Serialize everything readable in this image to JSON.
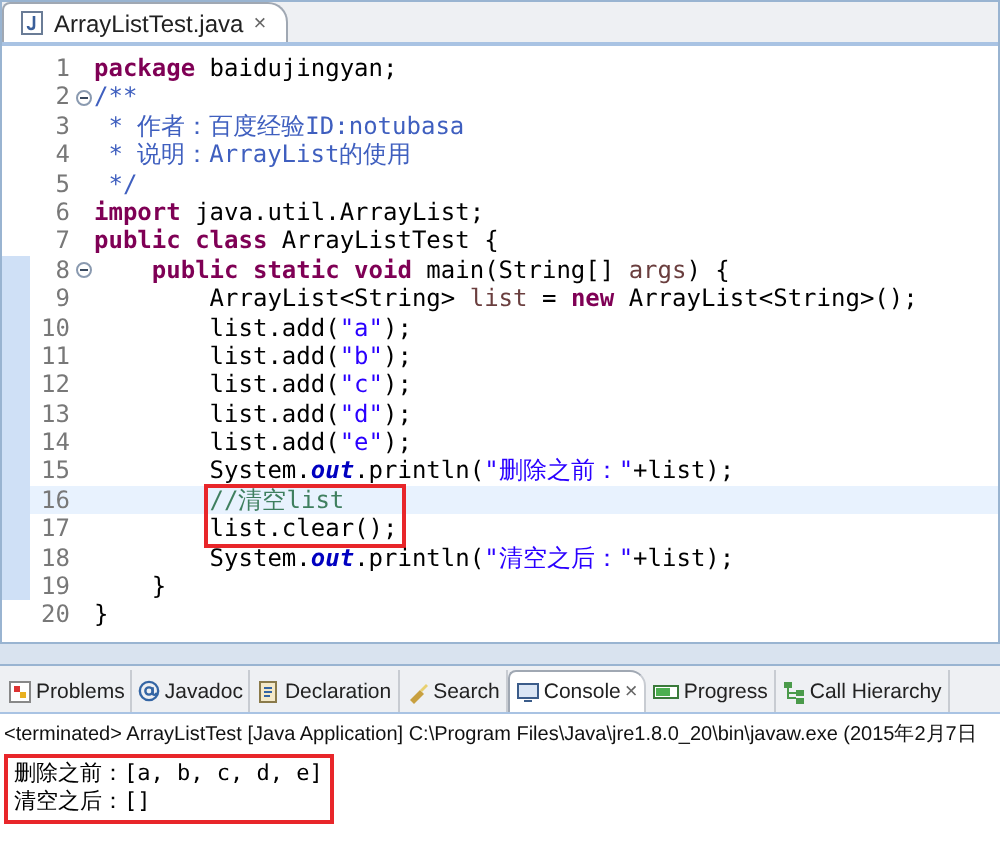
{
  "editor": {
    "tab": {
      "title": "ArrayListTest.java",
      "close": "×",
      "selected": true
    },
    "lines": [
      {
        "number": "1",
        "tokens": [
          {
            "kind": "keyword",
            "text": "package"
          },
          {
            "kind": "plain",
            "text": " baidujingyan;"
          }
        ]
      },
      {
        "number": "2",
        "fold": true,
        "tokens": [
          {
            "kind": "doc",
            "text": "/**"
          }
        ]
      },
      {
        "number": "3",
        "tokens": [
          {
            "kind": "doc",
            "text": " * 作者：百度经验ID:notubasa"
          }
        ]
      },
      {
        "number": "4",
        "tokens": [
          {
            "kind": "doc",
            "text": " * 说明：ArrayList的使用"
          }
        ]
      },
      {
        "number": "5",
        "tokens": [
          {
            "kind": "doc",
            "text": " */"
          }
        ]
      },
      {
        "number": "6",
        "tokens": [
          {
            "kind": "keyword",
            "text": "import"
          },
          {
            "kind": "plain",
            "text": " java.util.ArrayList;"
          }
        ]
      },
      {
        "number": "7",
        "tokens": [
          {
            "kind": "keyword",
            "text": "public class"
          },
          {
            "kind": "plain",
            "text": " ArrayListTest {"
          }
        ]
      },
      {
        "number": "8",
        "fold": true,
        "in_range": true,
        "tokens": [
          {
            "kind": "keyword",
            "text": "    public static void"
          },
          {
            "kind": "plain",
            "text": " main(String[] "
          },
          {
            "kind": "variable",
            "text": "args"
          },
          {
            "kind": "plain",
            "text": ") {"
          }
        ]
      },
      {
        "number": "9",
        "in_range": true,
        "tokens": [
          {
            "kind": "plain",
            "text": "        ArrayList<String> "
          },
          {
            "kind": "variable",
            "text": "list"
          },
          {
            "kind": "plain",
            "text": " = "
          },
          {
            "kind": "keyword",
            "text": "new"
          },
          {
            "kind": "plain",
            "text": " ArrayList<String>();"
          }
        ]
      },
      {
        "number": "10",
        "in_range": true,
        "tokens": [
          {
            "kind": "plain",
            "text": "        list.add("
          },
          {
            "kind": "string",
            "text": "\"a\""
          },
          {
            "kind": "plain",
            "text": ");"
          }
        ]
      },
      {
        "number": "11",
        "in_range": true,
        "tokens": [
          {
            "kind": "plain",
            "text": "        list.add("
          },
          {
            "kind": "string",
            "text": "\"b\""
          },
          {
            "kind": "plain",
            "text": ");"
          }
        ]
      },
      {
        "number": "12",
        "in_range": true,
        "tokens": [
          {
            "kind": "plain",
            "text": "        list.add("
          },
          {
            "kind": "string",
            "text": "\"c\""
          },
          {
            "kind": "plain",
            "text": ");"
          }
        ]
      },
      {
        "number": "13",
        "in_range": true,
        "tokens": [
          {
            "kind": "plain",
            "text": "        list.add("
          },
          {
            "kind": "string",
            "text": "\"d\""
          },
          {
            "kind": "plain",
            "text": ");"
          }
        ]
      },
      {
        "number": "14",
        "in_range": true,
        "tokens": [
          {
            "kind": "plain",
            "text": "        list.add("
          },
          {
            "kind": "string",
            "text": "\"e\""
          },
          {
            "kind": "plain",
            "text": ");"
          }
        ]
      },
      {
        "number": "15",
        "in_range": true,
        "tokens": [
          {
            "kind": "plain",
            "text": "        System."
          },
          {
            "kind": "field",
            "text": "out"
          },
          {
            "kind": "plain",
            "text": ".println("
          },
          {
            "kind": "string",
            "text": "\"删除之前：\""
          },
          {
            "kind": "plain",
            "text": "+list);"
          }
        ]
      },
      {
        "number": "16",
        "in_range": true,
        "current": true,
        "boxed": true,
        "tokens": [
          {
            "kind": "comment",
            "text": "        //清空list"
          }
        ]
      },
      {
        "number": "17",
        "in_range": true,
        "boxed": true,
        "tokens": [
          {
            "kind": "plain",
            "text": "        list.clear();"
          }
        ]
      },
      {
        "number": "18",
        "in_range": true,
        "tokens": [
          {
            "kind": "plain",
            "text": "        System."
          },
          {
            "kind": "field",
            "text": "out"
          },
          {
            "kind": "plain",
            "text": ".println("
          },
          {
            "kind": "string",
            "text": "\"清空之后：\""
          },
          {
            "kind": "plain",
            "text": "+list);"
          }
        ]
      },
      {
        "number": "19",
        "in_range": true,
        "tokens": [
          {
            "kind": "plain",
            "text": "    }"
          }
        ]
      },
      {
        "number": "20",
        "tokens": [
          {
            "kind": "plain",
            "text": "}"
          }
        ]
      }
    ]
  },
  "console": {
    "tabs": [
      {
        "label": "Problems",
        "selected": false
      },
      {
        "label": "Javadoc",
        "selected": false
      },
      {
        "label": "Declaration",
        "selected": false
      },
      {
        "label": "Search",
        "selected": false
      },
      {
        "label": "Console",
        "selected": true,
        "close": "×"
      },
      {
        "label": "Progress",
        "selected": false
      },
      {
        "label": "Call Hierarchy",
        "selected": false
      }
    ],
    "status": "<terminated> ArrayListTest [Java Application] C:\\Program Files\\Java\\jre1.8.0_20\\bin\\javaw.exe (2015年2月7日",
    "output": [
      {
        "text": "删除之前：[a, b, c, d, e]",
        "boxed": true
      },
      {
        "text": "清空之后：[]",
        "boxed": true
      }
    ]
  }
}
